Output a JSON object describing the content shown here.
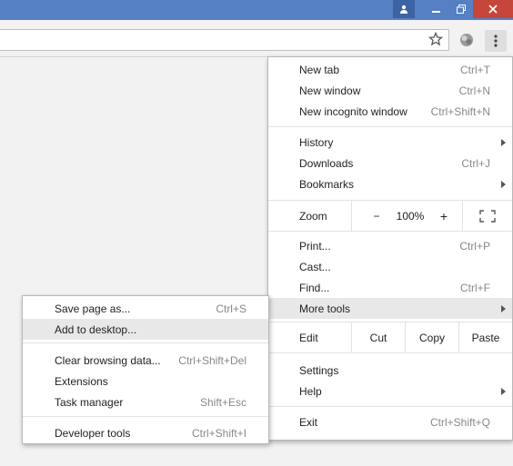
{
  "window": {
    "profile_icon": "person-icon",
    "minimize_icon": "minimize-icon",
    "restore_icon": "restore-icon",
    "close_icon": "close-icon",
    "titlebar_color": "#5580c4",
    "close_color": "#c7463b"
  },
  "toolbar": {
    "star_icon": "star-icon",
    "extension_icon": "extension-icon",
    "menu_icon": "three-dots-icon"
  },
  "main_menu": {
    "new_tab": {
      "label": "New tab",
      "shortcut": "Ctrl+T"
    },
    "new_window": {
      "label": "New window",
      "shortcut": "Ctrl+N"
    },
    "new_incognito": {
      "label": "New incognito window",
      "shortcut": "Ctrl+Shift+N"
    },
    "history": {
      "label": "History"
    },
    "downloads": {
      "label": "Downloads",
      "shortcut": "Ctrl+J"
    },
    "bookmarks": {
      "label": "Bookmarks"
    },
    "zoom": {
      "label": "Zoom",
      "minus": "−",
      "level": "100%",
      "plus": "+",
      "fullscreen_icon": "fullscreen-icon"
    },
    "print": {
      "label": "Print...",
      "shortcut": "Ctrl+P"
    },
    "cast": {
      "label": "Cast..."
    },
    "find": {
      "label": "Find...",
      "shortcut": "Ctrl+F"
    },
    "more_tools": {
      "label": "More tools"
    },
    "edit": {
      "label": "Edit",
      "cut": "Cut",
      "copy": "Copy",
      "paste": "Paste"
    },
    "settings": {
      "label": "Settings"
    },
    "help": {
      "label": "Help"
    },
    "exit": {
      "label": "Exit",
      "shortcut": "Ctrl+Shift+Q"
    }
  },
  "sub_menu": {
    "save_page": {
      "label": "Save page as...",
      "shortcut": "Ctrl+S"
    },
    "add_desktop": {
      "label": "Add to desktop..."
    },
    "clear_data": {
      "label": "Clear browsing data...",
      "shortcut": "Ctrl+Shift+Del"
    },
    "extensions": {
      "label": "Extensions"
    },
    "task_manager": {
      "label": "Task manager",
      "shortcut": "Shift+Esc"
    },
    "developer_tools": {
      "label": "Developer tools",
      "shortcut": "Ctrl+Shift+I"
    }
  }
}
